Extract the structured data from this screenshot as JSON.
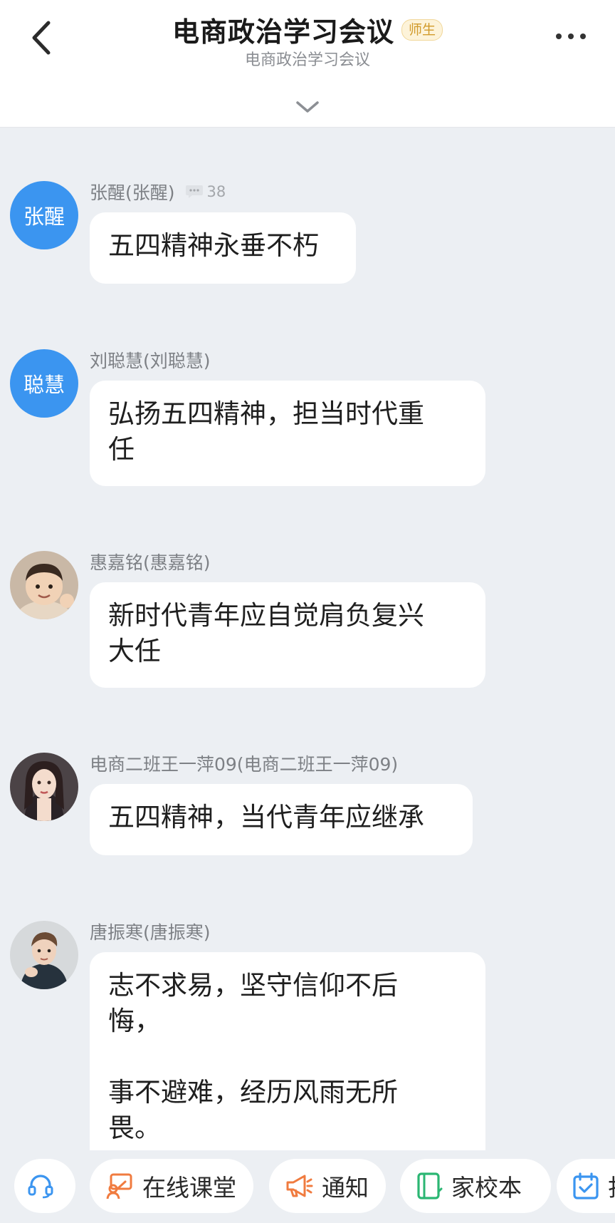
{
  "header": {
    "title": "电商政治学习会议",
    "role_badge": "师生",
    "subtitle": "电商政治学习会议"
  },
  "messages": [
    {
      "sender": "张醒(张醒)",
      "avatar_text": "张醒",
      "comment_count": "38",
      "text": "五四精神永垂不朽"
    },
    {
      "sender": "刘聪慧(刘聪慧)",
      "avatar_text": "聪慧",
      "text": "弘扬五四精神，担当时代重\n任"
    },
    {
      "sender": "惠嘉铭(惠嘉铭)",
      "text": "新时代青年应自觉肩负复兴\n大任"
    },
    {
      "sender": "电商二班王一萍09(电商二班王一萍09)",
      "text": "五四精神，当代青年应继承"
    },
    {
      "sender": "唐振寒(唐振寒)",
      "text": "志不求易，坚守信仰不后\n悔，\n\n事不避难，经历风雨无所\n畏。"
    }
  ],
  "toolbar": {
    "items": [
      {
        "label": ""
      },
      {
        "label": "在线课堂"
      },
      {
        "label": "通知"
      },
      {
        "label": "家校本"
      },
      {
        "label": "打"
      }
    ]
  },
  "colors": {
    "accent_blue": "#3b95f0",
    "page_background": "#eceff3",
    "badge_gold": "#d19a2a",
    "tool_orange": "#f07b3f",
    "tool_green": "#2bb673"
  }
}
